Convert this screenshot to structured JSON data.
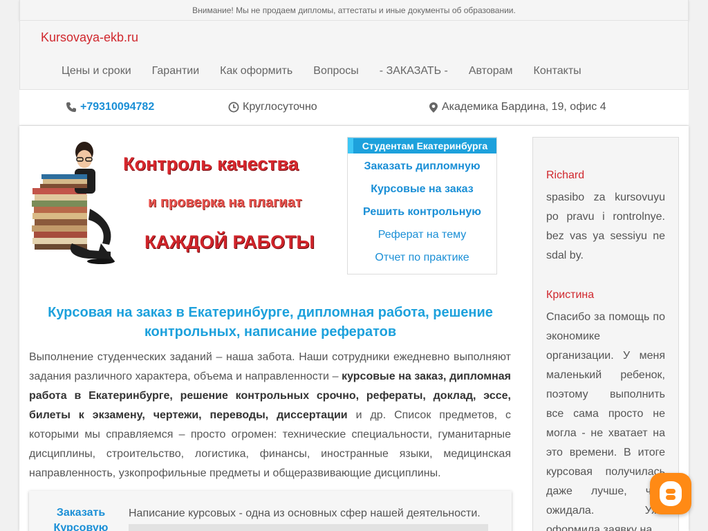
{
  "notice": "Внимание! Мы не продаем дипломы, аттестаты и иные документы об образовании.",
  "logo": "Kursovaya-ekb.ru",
  "nav": [
    "Цены и сроки",
    "Гарантии",
    "Как оформить",
    "Вопросы",
    "- ЗАКАЗАТЬ -",
    "Авторам",
    "Контакты"
  ],
  "contacts": {
    "phone": "+79310094782",
    "hours": "Круглосуточно",
    "address": "Академика Бардина, 19, офис 4"
  },
  "banner": {
    "line1": "Контроль качества",
    "line2": "и проверка на плагиат",
    "line3": "КАЖДОЙ РАБОТЫ"
  },
  "services": {
    "title": "Студентам Екатеринбурга",
    "links": [
      "Заказать дипломную",
      "Курсовые на заказ",
      "Решить контрольную",
      "Реферат на тему",
      "Отчет по практике"
    ]
  },
  "headline": "Курсовая на заказ в Екатеринбурге, дипломная работа, решение контрольных, написание рефератов",
  "intro": {
    "part1": "Выполнение студенческих заданий – наша забота. Наши сотрудники ежедневно выполняют задания различного характера, объема и направленности – ",
    "bold": "курсовые на заказ, дипломная работа в Екатеринбурге, решение контрольных срочно, рефераты, доклад, эссе, билеты к экзамену, чертежи, переводы, диссертации",
    "part2": " и др. Список предметов, с которыми мы справляемся – просто огромен: технические специальности, гуманитарные дисциплины, строительство, логистика, финансы, иностранные языки, медицинская направленность, узкопрофильные предметы и общеразвивающие дисциплины."
  },
  "card": {
    "link": "Заказать Курсовую",
    "text": "Написание курсовых - одна из основных сфер нашей деятельности."
  },
  "reviews": [
    {
      "name": "Richard",
      "text": "spasibo za kursovuyu po pravu i rontrolnye. bez vas ya sessiyu ne sdal by."
    },
    {
      "name": "Кристина",
      "text": "Спасибо за помощь по экономике организации. У меня маленький ребенок, поэтому выполнить все сама просто не могла - не хватает на это времени. В итоге курсовая получилась даже лучше, чем ожидала. Уже оформила заявку на"
    }
  ],
  "colors": {
    "accent_blue": "#1da1dc",
    "link_blue": "#1a8fd6",
    "brand_red": "#d0282e",
    "chat_orange": "#ff8a15"
  },
  "icons": {
    "phone": "phone-icon",
    "hours": "clock-icon",
    "address": "map-marker-icon",
    "chat": "chat-icon"
  }
}
